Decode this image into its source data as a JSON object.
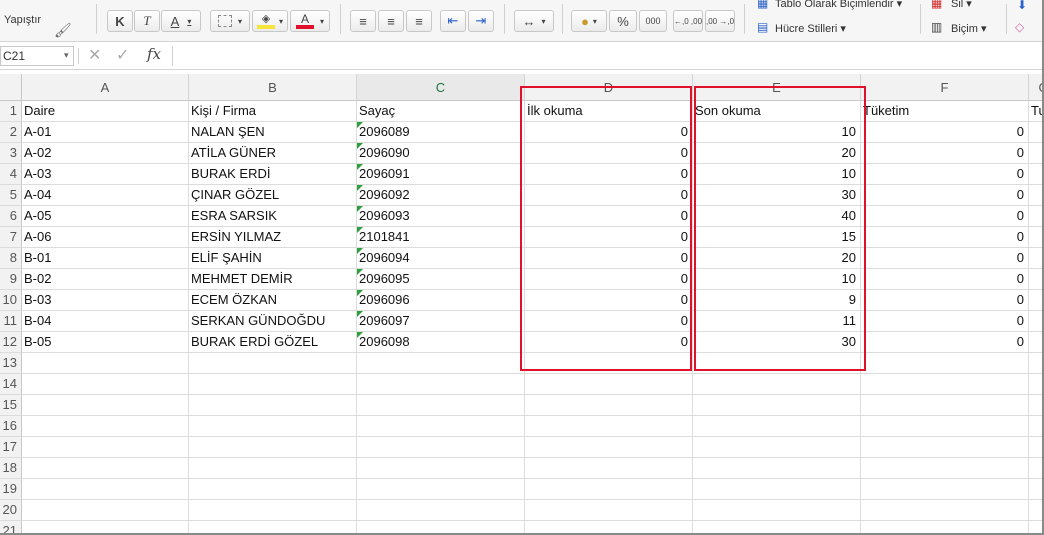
{
  "ribbon": {
    "paste_label": "Yapıştır",
    "bold": "K",
    "italic": "T",
    "underline": "A",
    "font_color_letter": "A",
    "percent": "%",
    "thousands": "000",
    "dec_increase": "←,0 ,00",
    "dec_decrease": ",00 →,0",
    "table_format": "Tablo Olarak Biçimlendir",
    "cell_styles": "Hücre Stilleri",
    "delete": "Sil",
    "format": "Biçim",
    "colors": {
      "fill": "#f5e53a",
      "font": "#e0112b"
    }
  },
  "formula_bar": {
    "name_box": "C21",
    "cancel_icon": "✕",
    "confirm_icon": "✓",
    "fx": "fx",
    "value": ""
  },
  "sheet": {
    "columns": [
      "A",
      "B",
      "C",
      "D",
      "E",
      "F",
      "G"
    ],
    "selected_column": "C",
    "row_numbers": [
      "1",
      "2",
      "3",
      "4",
      "5",
      "6",
      "7",
      "8",
      "9",
      "10",
      "11",
      "12",
      "13",
      "14",
      "15",
      "16",
      "17",
      "18",
      "19",
      "20",
      "21"
    ],
    "header_row": [
      "Daire",
      "Kişi / Firma",
      "Sayaç",
      "İlk okuma",
      "Son okuma",
      "Tüketim",
      "Tu"
    ],
    "rows": [
      [
        "A-01",
        "NALAN ŞEN",
        "2096089",
        "0",
        "10",
        "0"
      ],
      [
        "A-02",
        "ATİLA GÜNER",
        "2096090",
        "0",
        "20",
        "0"
      ],
      [
        "A-03",
        "BURAK ERDİ",
        "2096091",
        "0",
        "10",
        "0"
      ],
      [
        "A-04",
        "ÇINAR GÖZEL",
        "2096092",
        "0",
        "30",
        "0"
      ],
      [
        "A-05",
        "ESRA SARSIK",
        "2096093",
        "0",
        "40",
        "0"
      ],
      [
        "A-06",
        "ERSİN YILMAZ",
        "2101841",
        "0",
        "15",
        "0"
      ],
      [
        "B-01",
        "ELİF ŞAHİN",
        "2096094",
        "0",
        "20",
        "0"
      ],
      [
        "B-02",
        "MEHMET DEMİR",
        "2096095",
        "0",
        "10",
        "0"
      ],
      [
        "B-03",
        "ECEM ÖZKAN",
        "2096096",
        "0",
        "9",
        "0"
      ],
      [
        "B-04",
        "SERKAN GÜNDOĞDU",
        "2096097",
        "0",
        "11",
        "0"
      ],
      [
        "B-05",
        "BURAK ERDİ GÖZEL",
        "2096098",
        "0",
        "30",
        "0"
      ]
    ],
    "highlight_color": "#e0112b"
  }
}
